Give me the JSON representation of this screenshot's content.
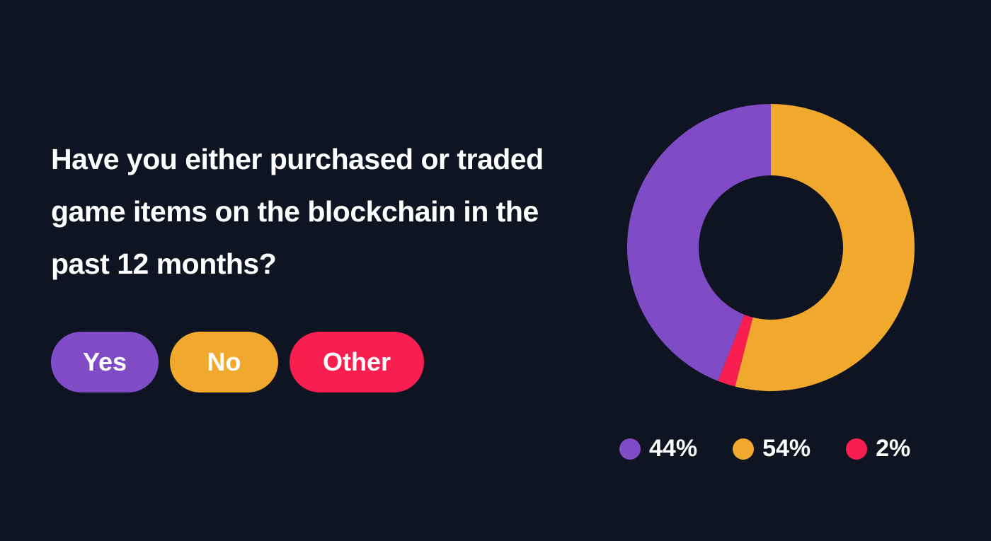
{
  "question": "Have you either purchased or traded game items on the blockchain in the past 12 months?",
  "options": [
    {
      "label": "Yes",
      "color": "#7f4cc6"
    },
    {
      "label": "No",
      "color": "#f0a92c"
    },
    {
      "label": "Other",
      "color": "#f81e50"
    }
  ],
  "chart_data": {
    "type": "pie",
    "variant": "donut",
    "start_angle_deg": 0,
    "direction": "clockwise",
    "categories": [
      "Yes",
      "No",
      "Other"
    ],
    "values": [
      44,
      54,
      2
    ],
    "value_labels": [
      "44%",
      "54%",
      "2%"
    ],
    "colors": [
      "#7f4cc6",
      "#f0a92c",
      "#f81e50"
    ],
    "slice_order": [
      "No",
      "Other",
      "Yes"
    ],
    "legend_position": "bottom"
  }
}
